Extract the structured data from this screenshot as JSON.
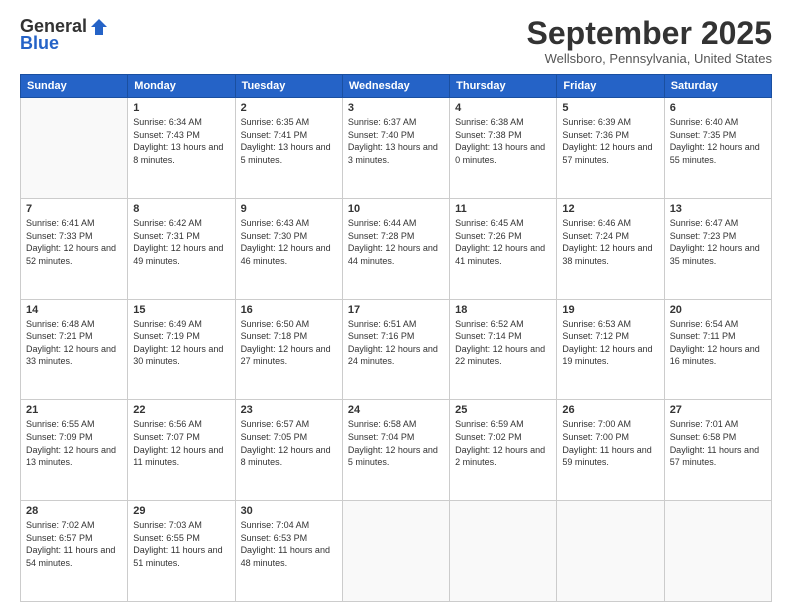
{
  "logo": {
    "general": "General",
    "blue": "Blue"
  },
  "header": {
    "month": "September 2025",
    "location": "Wellsboro, Pennsylvania, United States"
  },
  "days_of_week": [
    "Sunday",
    "Monday",
    "Tuesday",
    "Wednesday",
    "Thursday",
    "Friday",
    "Saturday"
  ],
  "weeks": [
    [
      {
        "day": "",
        "empty": true
      },
      {
        "day": "1",
        "sunrise": "Sunrise: 6:34 AM",
        "sunset": "Sunset: 7:43 PM",
        "daylight": "Daylight: 13 hours and 8 minutes."
      },
      {
        "day": "2",
        "sunrise": "Sunrise: 6:35 AM",
        "sunset": "Sunset: 7:41 PM",
        "daylight": "Daylight: 13 hours and 5 minutes."
      },
      {
        "day": "3",
        "sunrise": "Sunrise: 6:37 AM",
        "sunset": "Sunset: 7:40 PM",
        "daylight": "Daylight: 13 hours and 3 minutes."
      },
      {
        "day": "4",
        "sunrise": "Sunrise: 6:38 AM",
        "sunset": "Sunset: 7:38 PM",
        "daylight": "Daylight: 13 hours and 0 minutes."
      },
      {
        "day": "5",
        "sunrise": "Sunrise: 6:39 AM",
        "sunset": "Sunset: 7:36 PM",
        "daylight": "Daylight: 12 hours and 57 minutes."
      },
      {
        "day": "6",
        "sunrise": "Sunrise: 6:40 AM",
        "sunset": "Sunset: 7:35 PM",
        "daylight": "Daylight: 12 hours and 55 minutes."
      }
    ],
    [
      {
        "day": "7",
        "sunrise": "Sunrise: 6:41 AM",
        "sunset": "Sunset: 7:33 PM",
        "daylight": "Daylight: 12 hours and 52 minutes."
      },
      {
        "day": "8",
        "sunrise": "Sunrise: 6:42 AM",
        "sunset": "Sunset: 7:31 PM",
        "daylight": "Daylight: 12 hours and 49 minutes."
      },
      {
        "day": "9",
        "sunrise": "Sunrise: 6:43 AM",
        "sunset": "Sunset: 7:30 PM",
        "daylight": "Daylight: 12 hours and 46 minutes."
      },
      {
        "day": "10",
        "sunrise": "Sunrise: 6:44 AM",
        "sunset": "Sunset: 7:28 PM",
        "daylight": "Daylight: 12 hours and 44 minutes."
      },
      {
        "day": "11",
        "sunrise": "Sunrise: 6:45 AM",
        "sunset": "Sunset: 7:26 PM",
        "daylight": "Daylight: 12 hours and 41 minutes."
      },
      {
        "day": "12",
        "sunrise": "Sunrise: 6:46 AM",
        "sunset": "Sunset: 7:24 PM",
        "daylight": "Daylight: 12 hours and 38 minutes."
      },
      {
        "day": "13",
        "sunrise": "Sunrise: 6:47 AM",
        "sunset": "Sunset: 7:23 PM",
        "daylight": "Daylight: 12 hours and 35 minutes."
      }
    ],
    [
      {
        "day": "14",
        "sunrise": "Sunrise: 6:48 AM",
        "sunset": "Sunset: 7:21 PM",
        "daylight": "Daylight: 12 hours and 33 minutes."
      },
      {
        "day": "15",
        "sunrise": "Sunrise: 6:49 AM",
        "sunset": "Sunset: 7:19 PM",
        "daylight": "Daylight: 12 hours and 30 minutes."
      },
      {
        "day": "16",
        "sunrise": "Sunrise: 6:50 AM",
        "sunset": "Sunset: 7:18 PM",
        "daylight": "Daylight: 12 hours and 27 minutes."
      },
      {
        "day": "17",
        "sunrise": "Sunrise: 6:51 AM",
        "sunset": "Sunset: 7:16 PM",
        "daylight": "Daylight: 12 hours and 24 minutes."
      },
      {
        "day": "18",
        "sunrise": "Sunrise: 6:52 AM",
        "sunset": "Sunset: 7:14 PM",
        "daylight": "Daylight: 12 hours and 22 minutes."
      },
      {
        "day": "19",
        "sunrise": "Sunrise: 6:53 AM",
        "sunset": "Sunset: 7:12 PM",
        "daylight": "Daylight: 12 hours and 19 minutes."
      },
      {
        "day": "20",
        "sunrise": "Sunrise: 6:54 AM",
        "sunset": "Sunset: 7:11 PM",
        "daylight": "Daylight: 12 hours and 16 minutes."
      }
    ],
    [
      {
        "day": "21",
        "sunrise": "Sunrise: 6:55 AM",
        "sunset": "Sunset: 7:09 PM",
        "daylight": "Daylight: 12 hours and 13 minutes."
      },
      {
        "day": "22",
        "sunrise": "Sunrise: 6:56 AM",
        "sunset": "Sunset: 7:07 PM",
        "daylight": "Daylight: 12 hours and 11 minutes."
      },
      {
        "day": "23",
        "sunrise": "Sunrise: 6:57 AM",
        "sunset": "Sunset: 7:05 PM",
        "daylight": "Daylight: 12 hours and 8 minutes."
      },
      {
        "day": "24",
        "sunrise": "Sunrise: 6:58 AM",
        "sunset": "Sunset: 7:04 PM",
        "daylight": "Daylight: 12 hours and 5 minutes."
      },
      {
        "day": "25",
        "sunrise": "Sunrise: 6:59 AM",
        "sunset": "Sunset: 7:02 PM",
        "daylight": "Daylight: 12 hours and 2 minutes."
      },
      {
        "day": "26",
        "sunrise": "Sunrise: 7:00 AM",
        "sunset": "Sunset: 7:00 PM",
        "daylight": "Daylight: 11 hours and 59 minutes."
      },
      {
        "day": "27",
        "sunrise": "Sunrise: 7:01 AM",
        "sunset": "Sunset: 6:58 PM",
        "daylight": "Daylight: 11 hours and 57 minutes."
      }
    ],
    [
      {
        "day": "28",
        "sunrise": "Sunrise: 7:02 AM",
        "sunset": "Sunset: 6:57 PM",
        "daylight": "Daylight: 11 hours and 54 minutes."
      },
      {
        "day": "29",
        "sunrise": "Sunrise: 7:03 AM",
        "sunset": "Sunset: 6:55 PM",
        "daylight": "Daylight: 11 hours and 51 minutes."
      },
      {
        "day": "30",
        "sunrise": "Sunrise: 7:04 AM",
        "sunset": "Sunset: 6:53 PM",
        "daylight": "Daylight: 11 hours and 48 minutes."
      },
      {
        "day": "",
        "empty": true
      },
      {
        "day": "",
        "empty": true
      },
      {
        "day": "",
        "empty": true
      },
      {
        "day": "",
        "empty": true
      }
    ]
  ]
}
